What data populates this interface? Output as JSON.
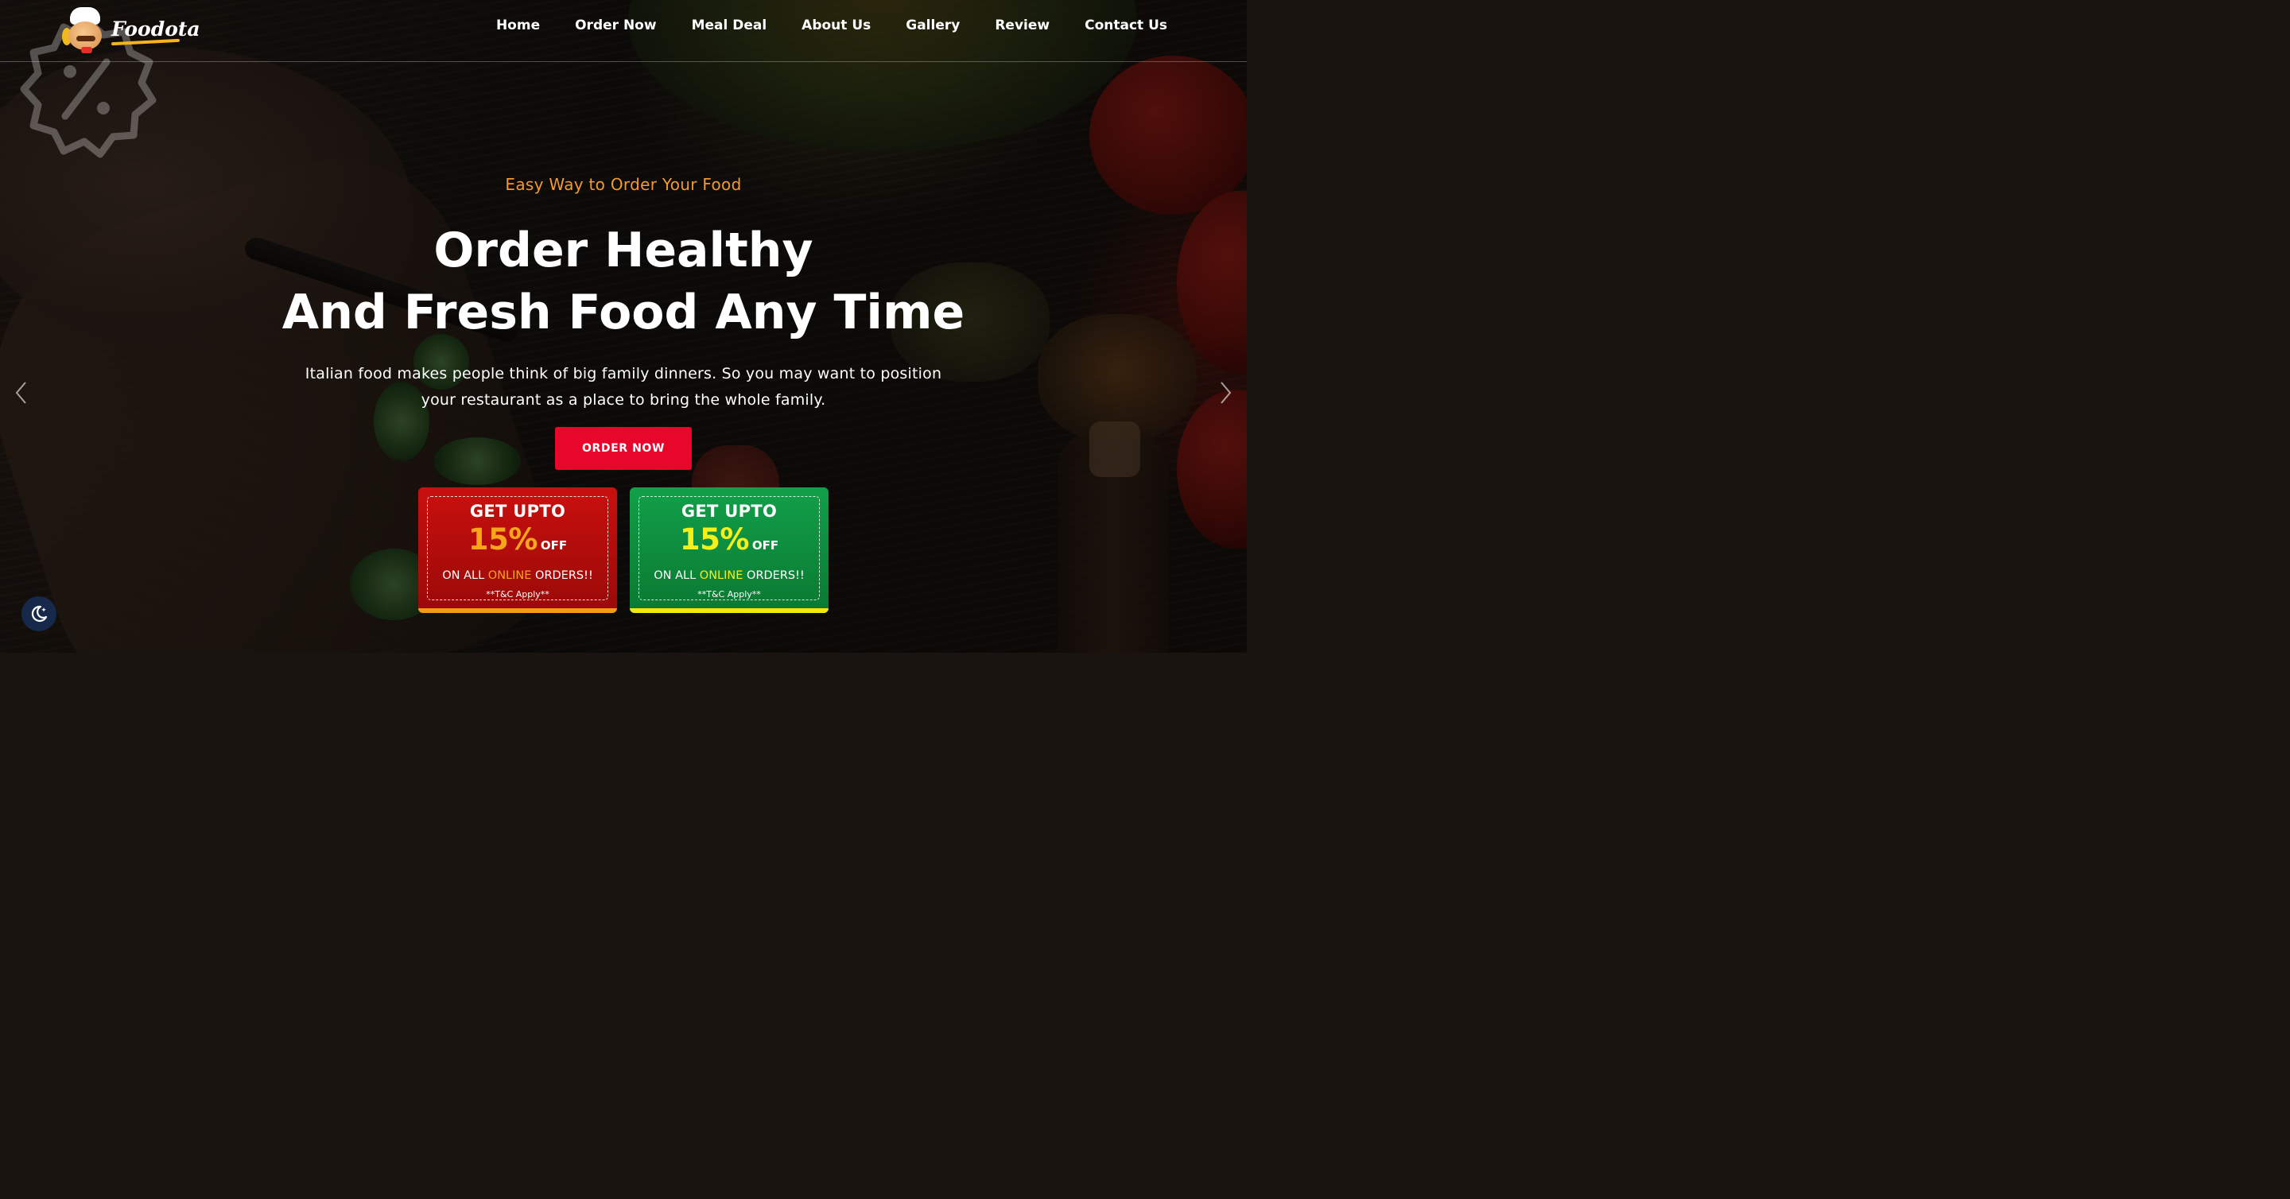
{
  "brand": {
    "name": "Foodota"
  },
  "nav": {
    "items": [
      "Home",
      "Order Now",
      "Meal Deal",
      "About Us",
      "Gallery",
      "Review",
      "Contact Us"
    ]
  },
  "hero": {
    "tagline": "Easy Way to Order Your Food",
    "title_line1": "Order Healthy",
    "title_line2": "And Fresh Food Any Time",
    "description": "Italian food makes people think of big family dinners. So you may want to position your restaurant as a place to bring the whole family.",
    "cta_label": "ORDER NOW"
  },
  "offers": [
    {
      "theme": "red",
      "line1": "GET UPTO",
      "percent": "15%",
      "off": "OFF",
      "pre": "ON ALL ",
      "highlight": "ONLINE",
      "post": " ORDERS!!",
      "terms": "**T&C Apply**"
    },
    {
      "theme": "green",
      "line1": "GET UPTO",
      "percent": "15%",
      "off": "OFF",
      "pre": "ON ALL ",
      "highlight": "ONLINE",
      "post": " ORDERS!!",
      "terms": "**T&C Apply**"
    }
  ],
  "icons": {
    "badge": "discount-badge-icon",
    "prev": "chevron-left-icon",
    "next": "chevron-right-icon",
    "mode": "moon-icon"
  },
  "colors": {
    "accent_red": "#e8062a",
    "tagline_orange": "#f29a2e",
    "offer_red": "#c9100e",
    "offer_green": "#12a04a",
    "highlight_orange": "#f6a51d",
    "highlight_yellow": "#f5ef1c"
  }
}
